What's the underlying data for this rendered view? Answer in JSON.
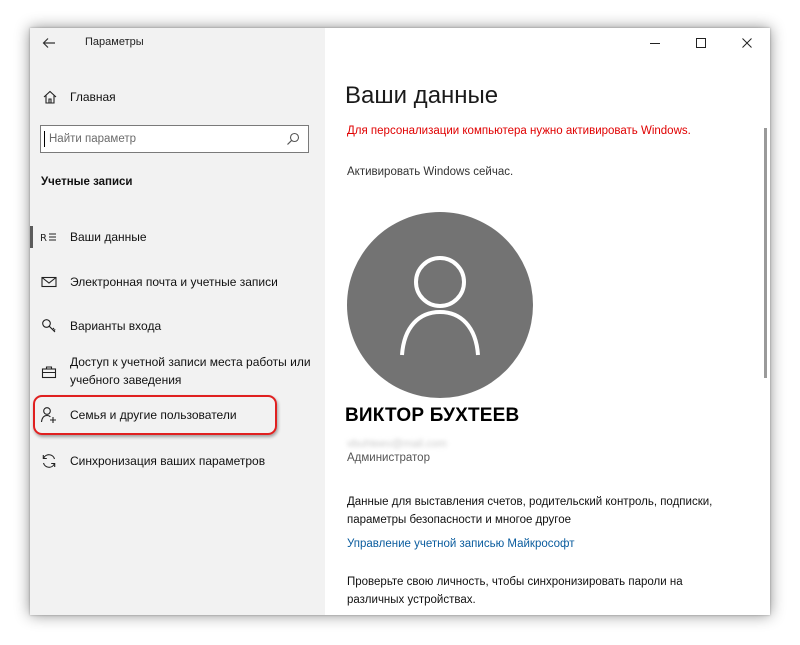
{
  "window": {
    "title": "Параметры"
  },
  "nav": {
    "home_label": "Главная",
    "search_placeholder": "Найти параметр",
    "section_heading": "Учетные записи",
    "items": [
      {
        "label": "Ваши данные",
        "icon": "person-card-icon",
        "selected": true
      },
      {
        "label": "Электронная почта и учетные записи",
        "icon": "mail-icon"
      },
      {
        "label": "Варианты входа",
        "icon": "key-icon"
      },
      {
        "label": "Доступ к учетной записи места работы или учебного заведения",
        "icon": "briefcase-icon"
      },
      {
        "label": "Семья и другие пользователи",
        "icon": "person-add-icon",
        "highlighted": true
      },
      {
        "label": "Синхронизация ваших параметров",
        "icon": "sync-icon"
      }
    ]
  },
  "content": {
    "title": "Ваши данные",
    "activation_warning": "Для персонализации компьютера нужно активировать Windows.",
    "activation_link": "Активировать Windows сейчас.",
    "user_name": "ВИКТОР БУХТЕЕВ",
    "user_email": "vbuhteev@mail.com",
    "user_role": "Администратор",
    "info_text": "Данные для выставления счетов, родительский контроль, подписки, параметры безопасности и многое другое",
    "ms_link": "Управление учетной записью Майкрософт",
    "verify_text": "Проверьте свою личность, чтобы синхронизировать пароли на различных устройствах."
  },
  "colors": {
    "nav_bg": "#f2f2f2",
    "warning": "#e00000",
    "link": "#0a5c9e",
    "avatar_bg": "#737373",
    "highlight": "#e02020"
  }
}
